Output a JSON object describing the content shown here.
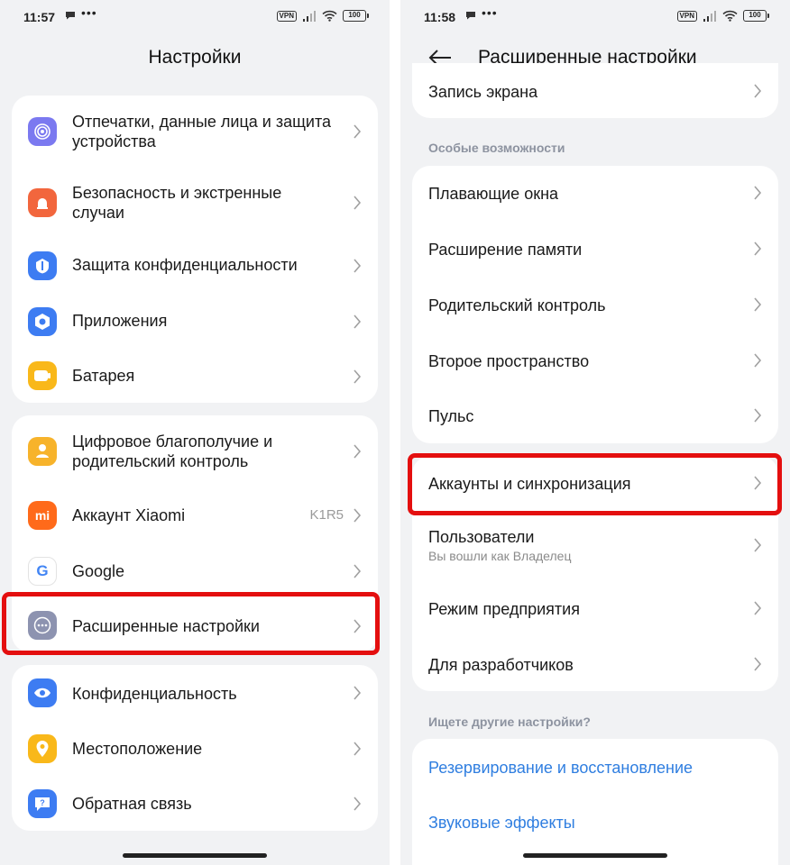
{
  "left": {
    "status": {
      "time": "11:57",
      "vpn": "VPN",
      "battery": "100"
    },
    "title": "Настройки",
    "groups": [
      [
        {
          "label": "Отпечатки, данные лица и защита устройства",
          "icon": "fingerprint-icon",
          "color": "#7b79f0"
        },
        {
          "label": "Безопасность и экстренные случаи",
          "icon": "emergency-icon",
          "color": "#f2663d"
        },
        {
          "label": "Защита конфиденциальности",
          "icon": "privacy-shield-icon",
          "color": "#3d7cf2"
        },
        {
          "label": "Приложения",
          "icon": "apps-gear-icon",
          "color": "#3d7cf2"
        },
        {
          "label": "Батарея",
          "icon": "battery-icon",
          "color": "#f9b81a"
        }
      ],
      [
        {
          "label": "Цифровое благополучие и родительский контроль",
          "icon": "wellbeing-icon",
          "color": "#f7b32b"
        },
        {
          "label": "Аккаунт Xiaomi",
          "icon": "xiaomi-icon",
          "color": "#ff6a1a",
          "value": "K1R5"
        },
        {
          "label": "Google",
          "icon": "google-icon",
          "color": "#ffffff"
        },
        {
          "label": "Расширенные настройки",
          "icon": "more-dots-icon",
          "color": "#8d93b0"
        }
      ],
      [
        {
          "label": "Конфиденциальность",
          "icon": "eye-icon",
          "color": "#3d7cf2"
        },
        {
          "label": "Местоположение",
          "icon": "location-pin-icon",
          "color": "#f9b81a"
        },
        {
          "label": "Обратная связь",
          "icon": "feedback-icon",
          "color": "#3d7cf2"
        }
      ]
    ]
  },
  "right": {
    "status": {
      "time": "11:58",
      "vpn": "VPN",
      "battery": "100"
    },
    "title": "Расширенные настройки",
    "top_item": "Запись экрана",
    "section_special": "Особые возможности",
    "special_items": [
      "Плавающие окна",
      "Расширение памяти",
      "Родительский контроль",
      "Второе пространство",
      "Пульс"
    ],
    "account_items": [
      {
        "label": "Аккаунты и синхронизация"
      },
      {
        "label": "Пользователи",
        "sub": "Вы вошли как Владелец"
      },
      {
        "label": "Режим предприятия"
      },
      {
        "label": "Для разработчиков"
      }
    ],
    "section_other": "Ищете другие настройки?",
    "other_links": [
      "Резервирование и восстановление",
      "Звуковые эффекты"
    ]
  },
  "colors": {
    "highlight": "#e40f0f",
    "link": "#2f7ee0",
    "background": "#f1f2f4"
  }
}
